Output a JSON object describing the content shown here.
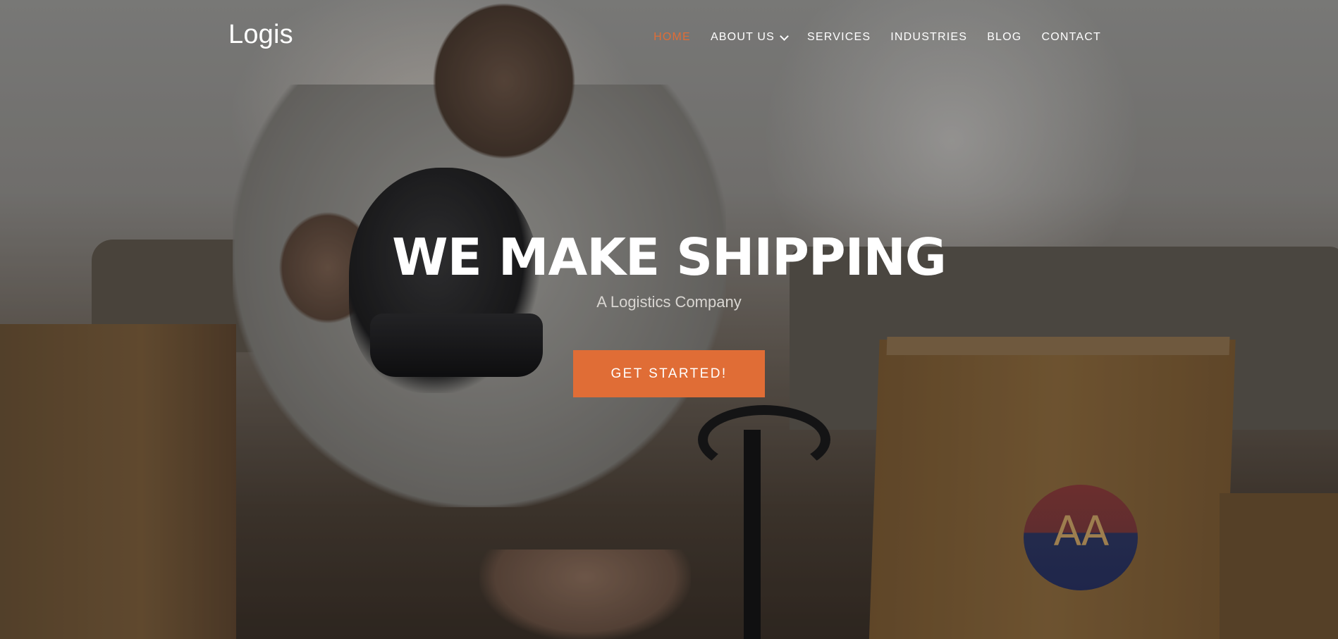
{
  "brand": {
    "logo_text": "Logis"
  },
  "nav": {
    "items": [
      {
        "label": "HOME",
        "active": true
      },
      {
        "label": "ABOUT US",
        "has_dropdown": true
      },
      {
        "label": "SERVICES"
      },
      {
        "label": "INDUSTRIES"
      },
      {
        "label": "BLOG"
      },
      {
        "label": "CONTACT"
      }
    ]
  },
  "hero": {
    "headline": "WE MAKE SHIPPING",
    "subheadline": "A Logistics Company",
    "cta_label": "GET STARTED!",
    "sticker_text": "AA"
  },
  "colors": {
    "accent": "#e06d36",
    "text": "#ffffff",
    "subtext": "#d9d6d2"
  },
  "icons": {
    "dropdown": "chevron-down-icon"
  }
}
